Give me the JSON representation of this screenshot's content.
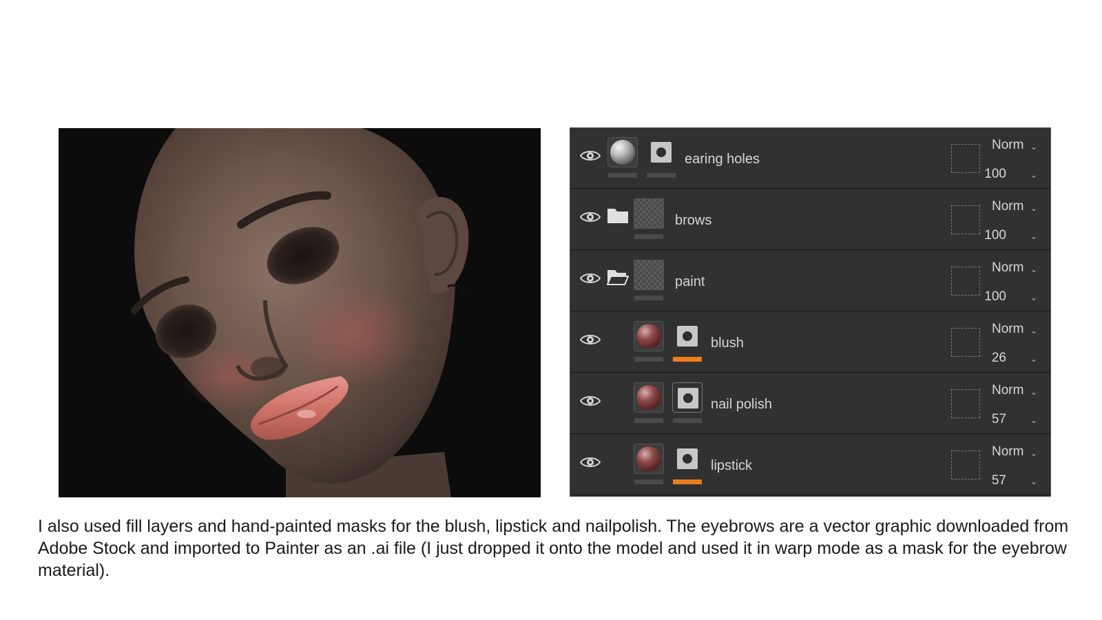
{
  "layers": [
    {
      "name": "earing holes",
      "thumb": "sphere-grey",
      "mask": true,
      "folder": "none",
      "blend": "Norm",
      "opacity": "100",
      "mask_selected": false,
      "bar_orange": false
    },
    {
      "name": "brows",
      "thumb": "checker",
      "mask": false,
      "folder": "closed",
      "blend": "Norm",
      "opacity": "100",
      "mask_selected": false,
      "bar_orange": false
    },
    {
      "name": "paint",
      "thumb": "checker",
      "mask": false,
      "folder": "open",
      "blend": "Norm",
      "opacity": "100",
      "mask_selected": false,
      "bar_orange": false
    },
    {
      "name": "blush",
      "thumb": "sphere-red",
      "mask": true,
      "folder": "none",
      "blend": "Norm",
      "opacity": "26",
      "mask_selected": false,
      "bar_orange": true
    },
    {
      "name": "nail polish",
      "thumb": "sphere-red",
      "mask": true,
      "folder": "none",
      "blend": "Norm",
      "opacity": "57",
      "mask_selected": true,
      "bar_orange": false
    },
    {
      "name": "lipstick",
      "thumb": "sphere-red",
      "mask": true,
      "folder": "none",
      "blend": "Norm",
      "opacity": "57",
      "mask_selected": false,
      "bar_orange": true
    }
  ],
  "caption": "I also used fill layers and hand-painted masks for the blush, lipstick and nailpolish. The eyebrows are a vector graphic downloaded from Adobe Stock and imported to Painter as an .ai file (I just dropped it onto the model and used it in warp mode as a mask for the eyebrow material).",
  "colors": {
    "panel": "#313131",
    "accent": "#ee7d1c",
    "text": "#d6d6d6"
  }
}
